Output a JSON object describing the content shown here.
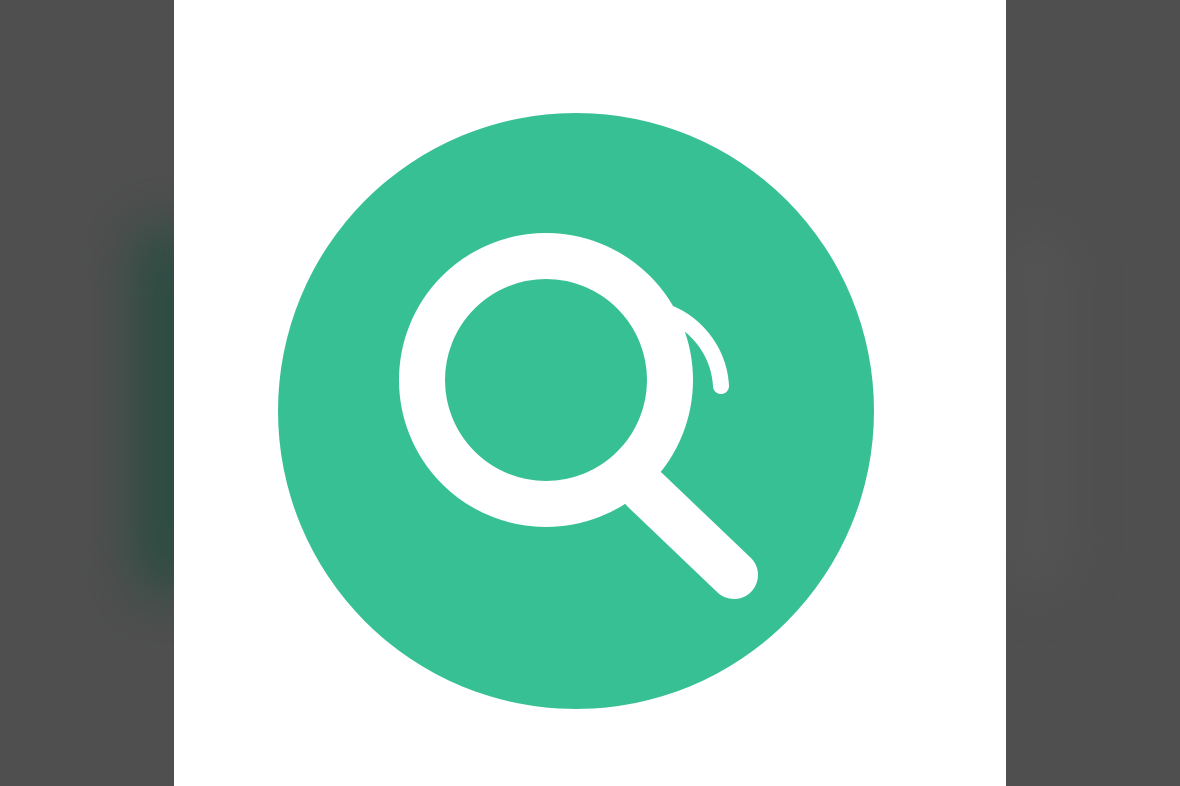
{
  "colors": {
    "background": "#4f4f4f",
    "panel": "#ffffff",
    "accent": "#38c095",
    "glyph": "#ffffff"
  },
  "icon": {
    "name": "search-icon",
    "shape": "magnifying-glass-in-circle"
  }
}
